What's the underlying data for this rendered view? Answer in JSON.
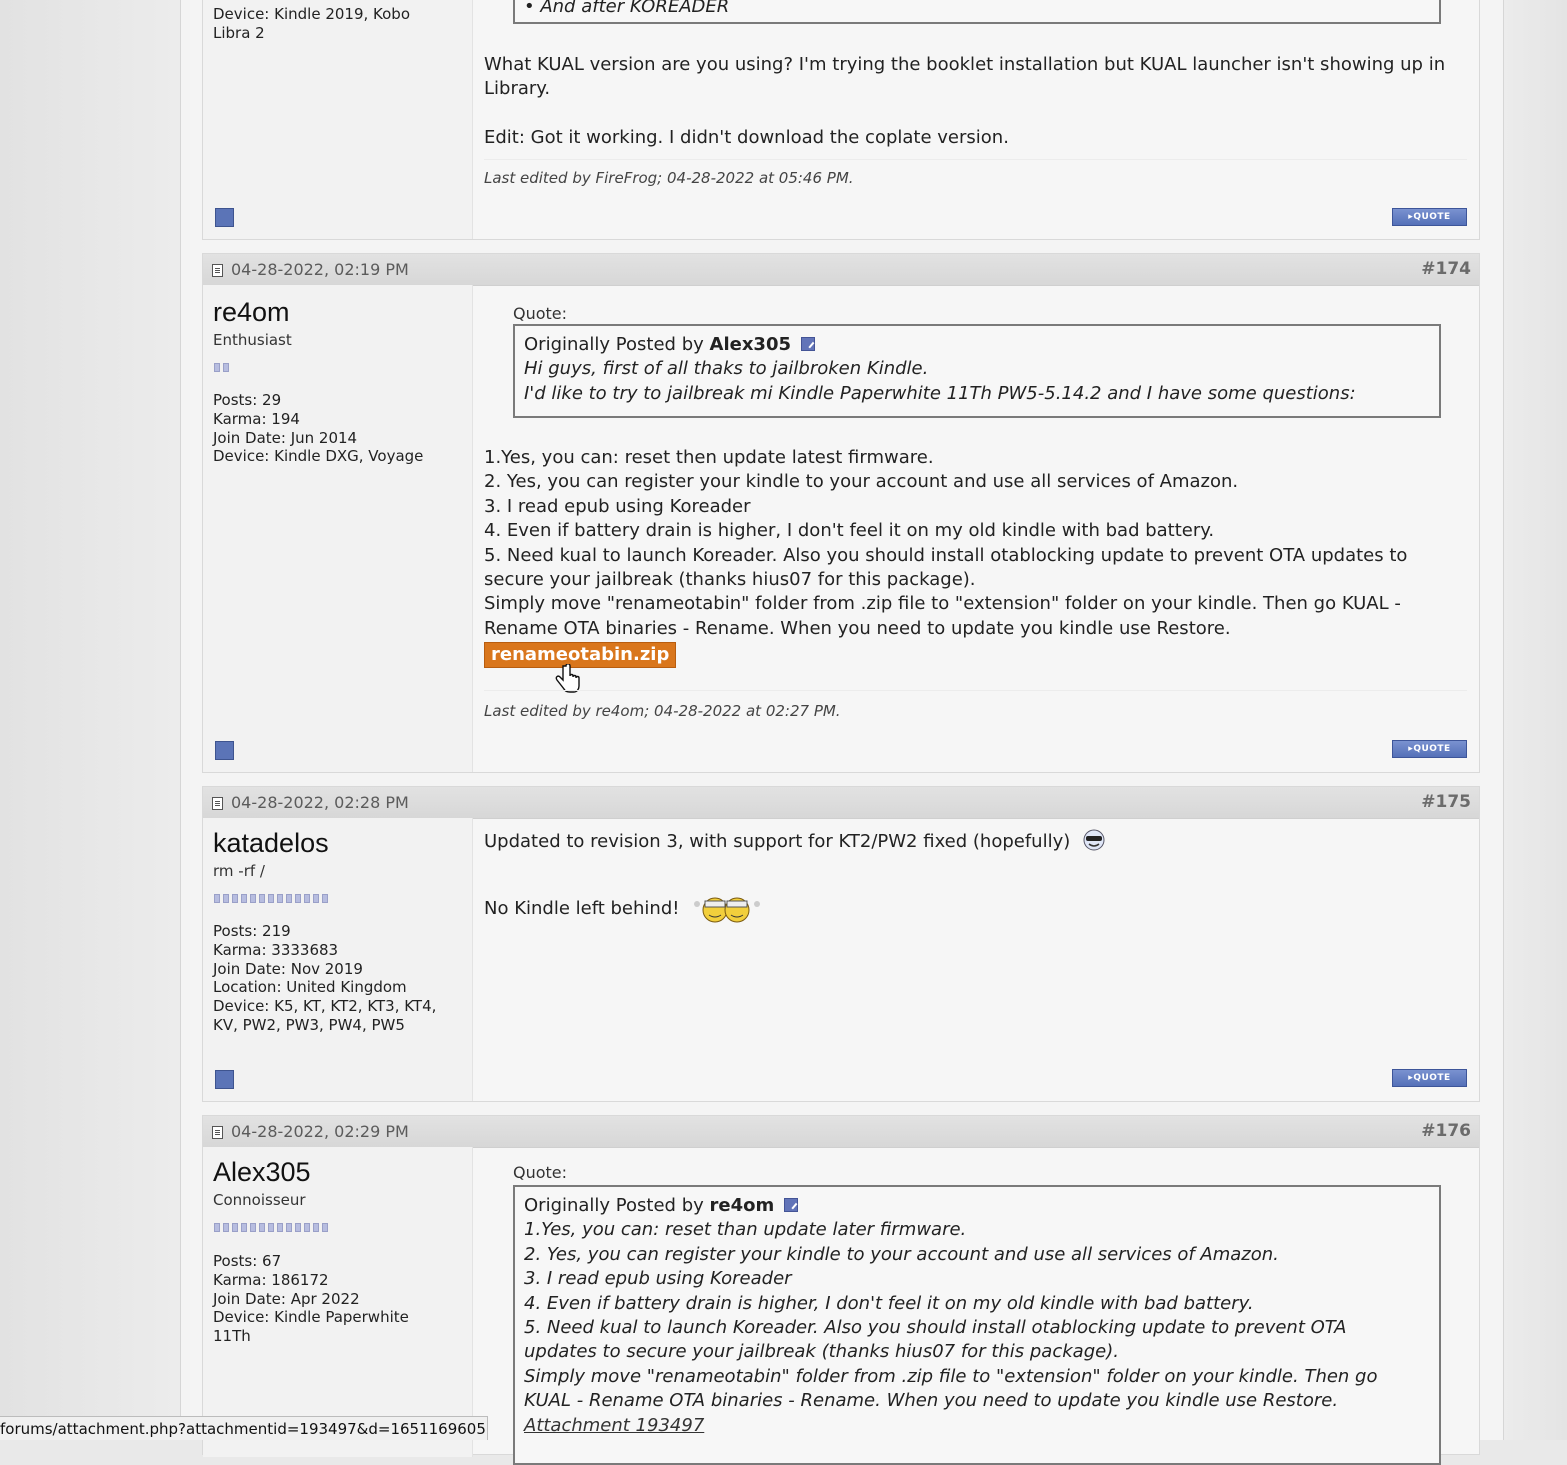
{
  "post_top": {
    "device_line1": "Device: Kindle 2019, Kobo",
    "device_line2": "Libra 2",
    "quote_tail": "• And after KOREADER",
    "body1": "What KUAL version are you using? I'm trying the booklet installation but KUAL launcher isn't showing up in Library.",
    "body2": "Edit: Got it working. I didn't download the coplate version.",
    "edited": "Last edited by FireFrog; 04-28-2022 at 05:46 PM.",
    "quote_button": "QUOTE"
  },
  "post_174": {
    "date": "04-28-2022, 02:19 PM",
    "number": "#174",
    "username": "re4om",
    "user_title": "Enthusiast",
    "stats": [
      "Posts: 29",
      "Karma: 194",
      "Join Date: Jun 2014",
      "Device: Kindle DXG, Voyage"
    ],
    "quote_label": "Quote:",
    "quote_prefix": "Originally Posted by",
    "quote_author": "Alex305",
    "quote_lines": [
      "Hi guys, first of all thaks to jailbroken Kindle.",
      "I'd like to try to jailbreak mi Kindle Paperwhite 11Th PW5-5.14.2 and I have some questions:"
    ],
    "body_lines": [
      "1.Yes, you can: reset then update latest firmware.",
      "2. Yes, you can register your kindle to your account and use all services of Amazon.",
      "3. I read epub using Koreader",
      "4. Even if battery drain is higher, I don't feel it on my old kindle with bad battery.",
      "5. Need kual to launch Koreader. Also you should install otablocking update to prevent OTA updates to",
      "secure your jailbreak (thanks hius07 for this package).",
      "Simply move \"renameotabin\" folder from .zip file to \"extension\" folder on your kindle. Then go KUAL -",
      "Rename OTA binaries - Rename. When you need to update you kindle use Restore."
    ],
    "attachment": "renameotabin.zip",
    "edited": "Last edited by re4om; 04-28-2022 at 02:27 PM.",
    "quote_button": "QUOTE"
  },
  "post_175": {
    "date": "04-28-2022, 02:28 PM",
    "number": "#175",
    "username": "katadelos",
    "user_title": "rm -rf /",
    "stats": [
      "Posts: 219",
      "Karma: 3333683",
      "Join Date: Nov 2019",
      "Location: United Kingdom",
      "Device: K5, KT, KT2, KT3, KT4,",
      "KV, PW2, PW3, PW4, PW5"
    ],
    "body1": "Updated to revision 3, with support for KT2/PW2 fixed (hopefully)",
    "body2": "No Kindle left behind!",
    "quote_button": "QUOTE"
  },
  "post_176": {
    "date": "04-28-2022, 02:29 PM",
    "number": "#176",
    "username": "Alex305",
    "user_title": "Connoisseur",
    "stats": [
      "Posts: 67",
      "Karma: 186172",
      "Join Date: Apr 2022",
      "Device: Kindle Paperwhite",
      "11Th"
    ],
    "quote_label": "Quote:",
    "quote_prefix": "Originally Posted by",
    "quote_author": "re4om",
    "quote_lines": [
      "1.Yes, you can: reset than update later firmware.",
      "2. Yes, you can register your kindle to your account and use all services of Amazon.",
      "3. I read epub using Koreader",
      "4. Even if battery drain is higher, I don't feel it on my old kindle with bad battery.",
      "5. Need kual to launch Koreader. Also you should install otablocking update to prevent OTA",
      "updates to secure your jailbreak (thanks hius07 for this package).",
      "Simply move \"renameotabin\" folder from .zip file to \"extension\" folder on your kindle. Then go",
      "KUAL - Rename OTA binaries - Rename. When you need to update you kindle use Restore."
    ],
    "quote_attachment": "Attachment 193497"
  },
  "status_bar": "forums/attachment.php?attachmentid=193497&d=1651169605"
}
